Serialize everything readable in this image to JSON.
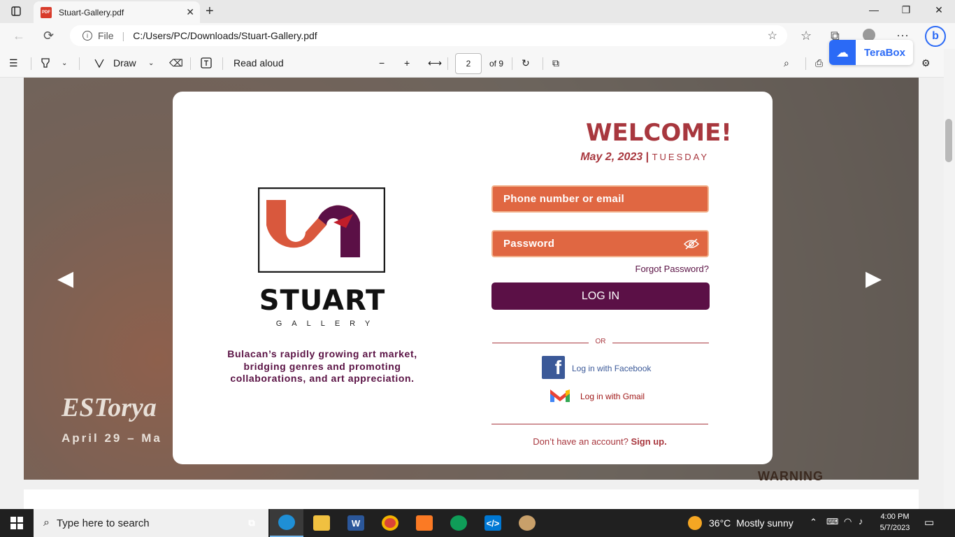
{
  "browser": {
    "tab_title": "Stuart-Gallery.pdf",
    "pdf_icon_text": "PDF",
    "address_scheme": "File",
    "address_path": "C:/Users/PC/Downloads/Stuart-Gallery.pdf"
  },
  "pdf_toolbar": {
    "draw_label": "Draw",
    "read_aloud_label": "Read aloud",
    "page_number": "2",
    "page_total": "of 9"
  },
  "extension": {
    "name": "TeraBox"
  },
  "document": {
    "bg_title": "ESTorya",
    "bg_date": "April 29 – Ma",
    "bg_sign": "WARNING"
  },
  "login": {
    "welcome": "WELCOME!",
    "date": "May 2, 2023",
    "date_separator": "|",
    "weekday": "TUESDAY",
    "email_placeholder": "Phone number or email",
    "password_placeholder": "Password",
    "forgot_password": "Forgot Password?",
    "login_button": "LOG IN",
    "or_label": "OR",
    "facebook_label": "Log in with Facebook",
    "gmail_label": "Log in with Gmail",
    "signup_prompt": "Don’t have an account?",
    "signup_link": "Sign up."
  },
  "brand": {
    "name": "STUART",
    "subname": "GALLERY",
    "tagline": "Bulacan’s rapidly growing art market, bridging genres and promoting collaborations, and art appreciation.",
    "colors": {
      "accent": "#a8373e",
      "field": "#e06742",
      "button": "#5b1046"
    }
  },
  "taskbar": {
    "search_placeholder": "Type here to search",
    "temperature": "36°C",
    "weather_desc": "Mostly sunny",
    "time": "4:00 PM",
    "date": "5/7/2023"
  }
}
